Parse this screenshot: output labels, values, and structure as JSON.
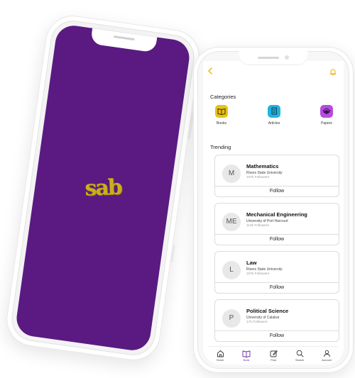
{
  "app": {
    "logo_text": "sab",
    "header": {
      "back_icon": "chevron-left-icon",
      "bell_icon": "bell-icon",
      "accent": "#e7b400"
    },
    "categories": {
      "heading": "Categories",
      "items": [
        {
          "label": "Books",
          "icon": "book-icon",
          "color": "#e6c21a"
        },
        {
          "label": "Articles",
          "icon": "document-icon",
          "color": "#23b3e0"
        },
        {
          "label": "Papers",
          "icon": "stack-icon",
          "color": "#b44de0"
        }
      ]
    },
    "trending": {
      "heading": "Trending",
      "follow_label": "Follow",
      "items": [
        {
          "initials": "M",
          "title": "Mathematics",
          "university": "Rivers State University",
          "followers": "167k Followers"
        },
        {
          "initials": "ME",
          "title": "Mechanical Engineering",
          "university": "University of Port Harcourt",
          "followers": "112k Followers"
        },
        {
          "initials": "L",
          "title": "Law",
          "university": "Rivers State University",
          "followers": "167k Followers"
        },
        {
          "initials": "P",
          "title": "Political Science",
          "university": "University of Calabar",
          "followers": "17k Followers"
        }
      ]
    },
    "tabs": [
      {
        "label": "Home",
        "icon": "home-icon"
      },
      {
        "label": "Book",
        "icon": "book-icon",
        "active": true
      },
      {
        "label": "Post",
        "icon": "edit-icon"
      },
      {
        "label": "Search",
        "icon": "search-icon"
      },
      {
        "label": "Account",
        "icon": "user-icon"
      }
    ],
    "splash_color": "#5a1a82",
    "active_color": "#6a2aa8"
  }
}
